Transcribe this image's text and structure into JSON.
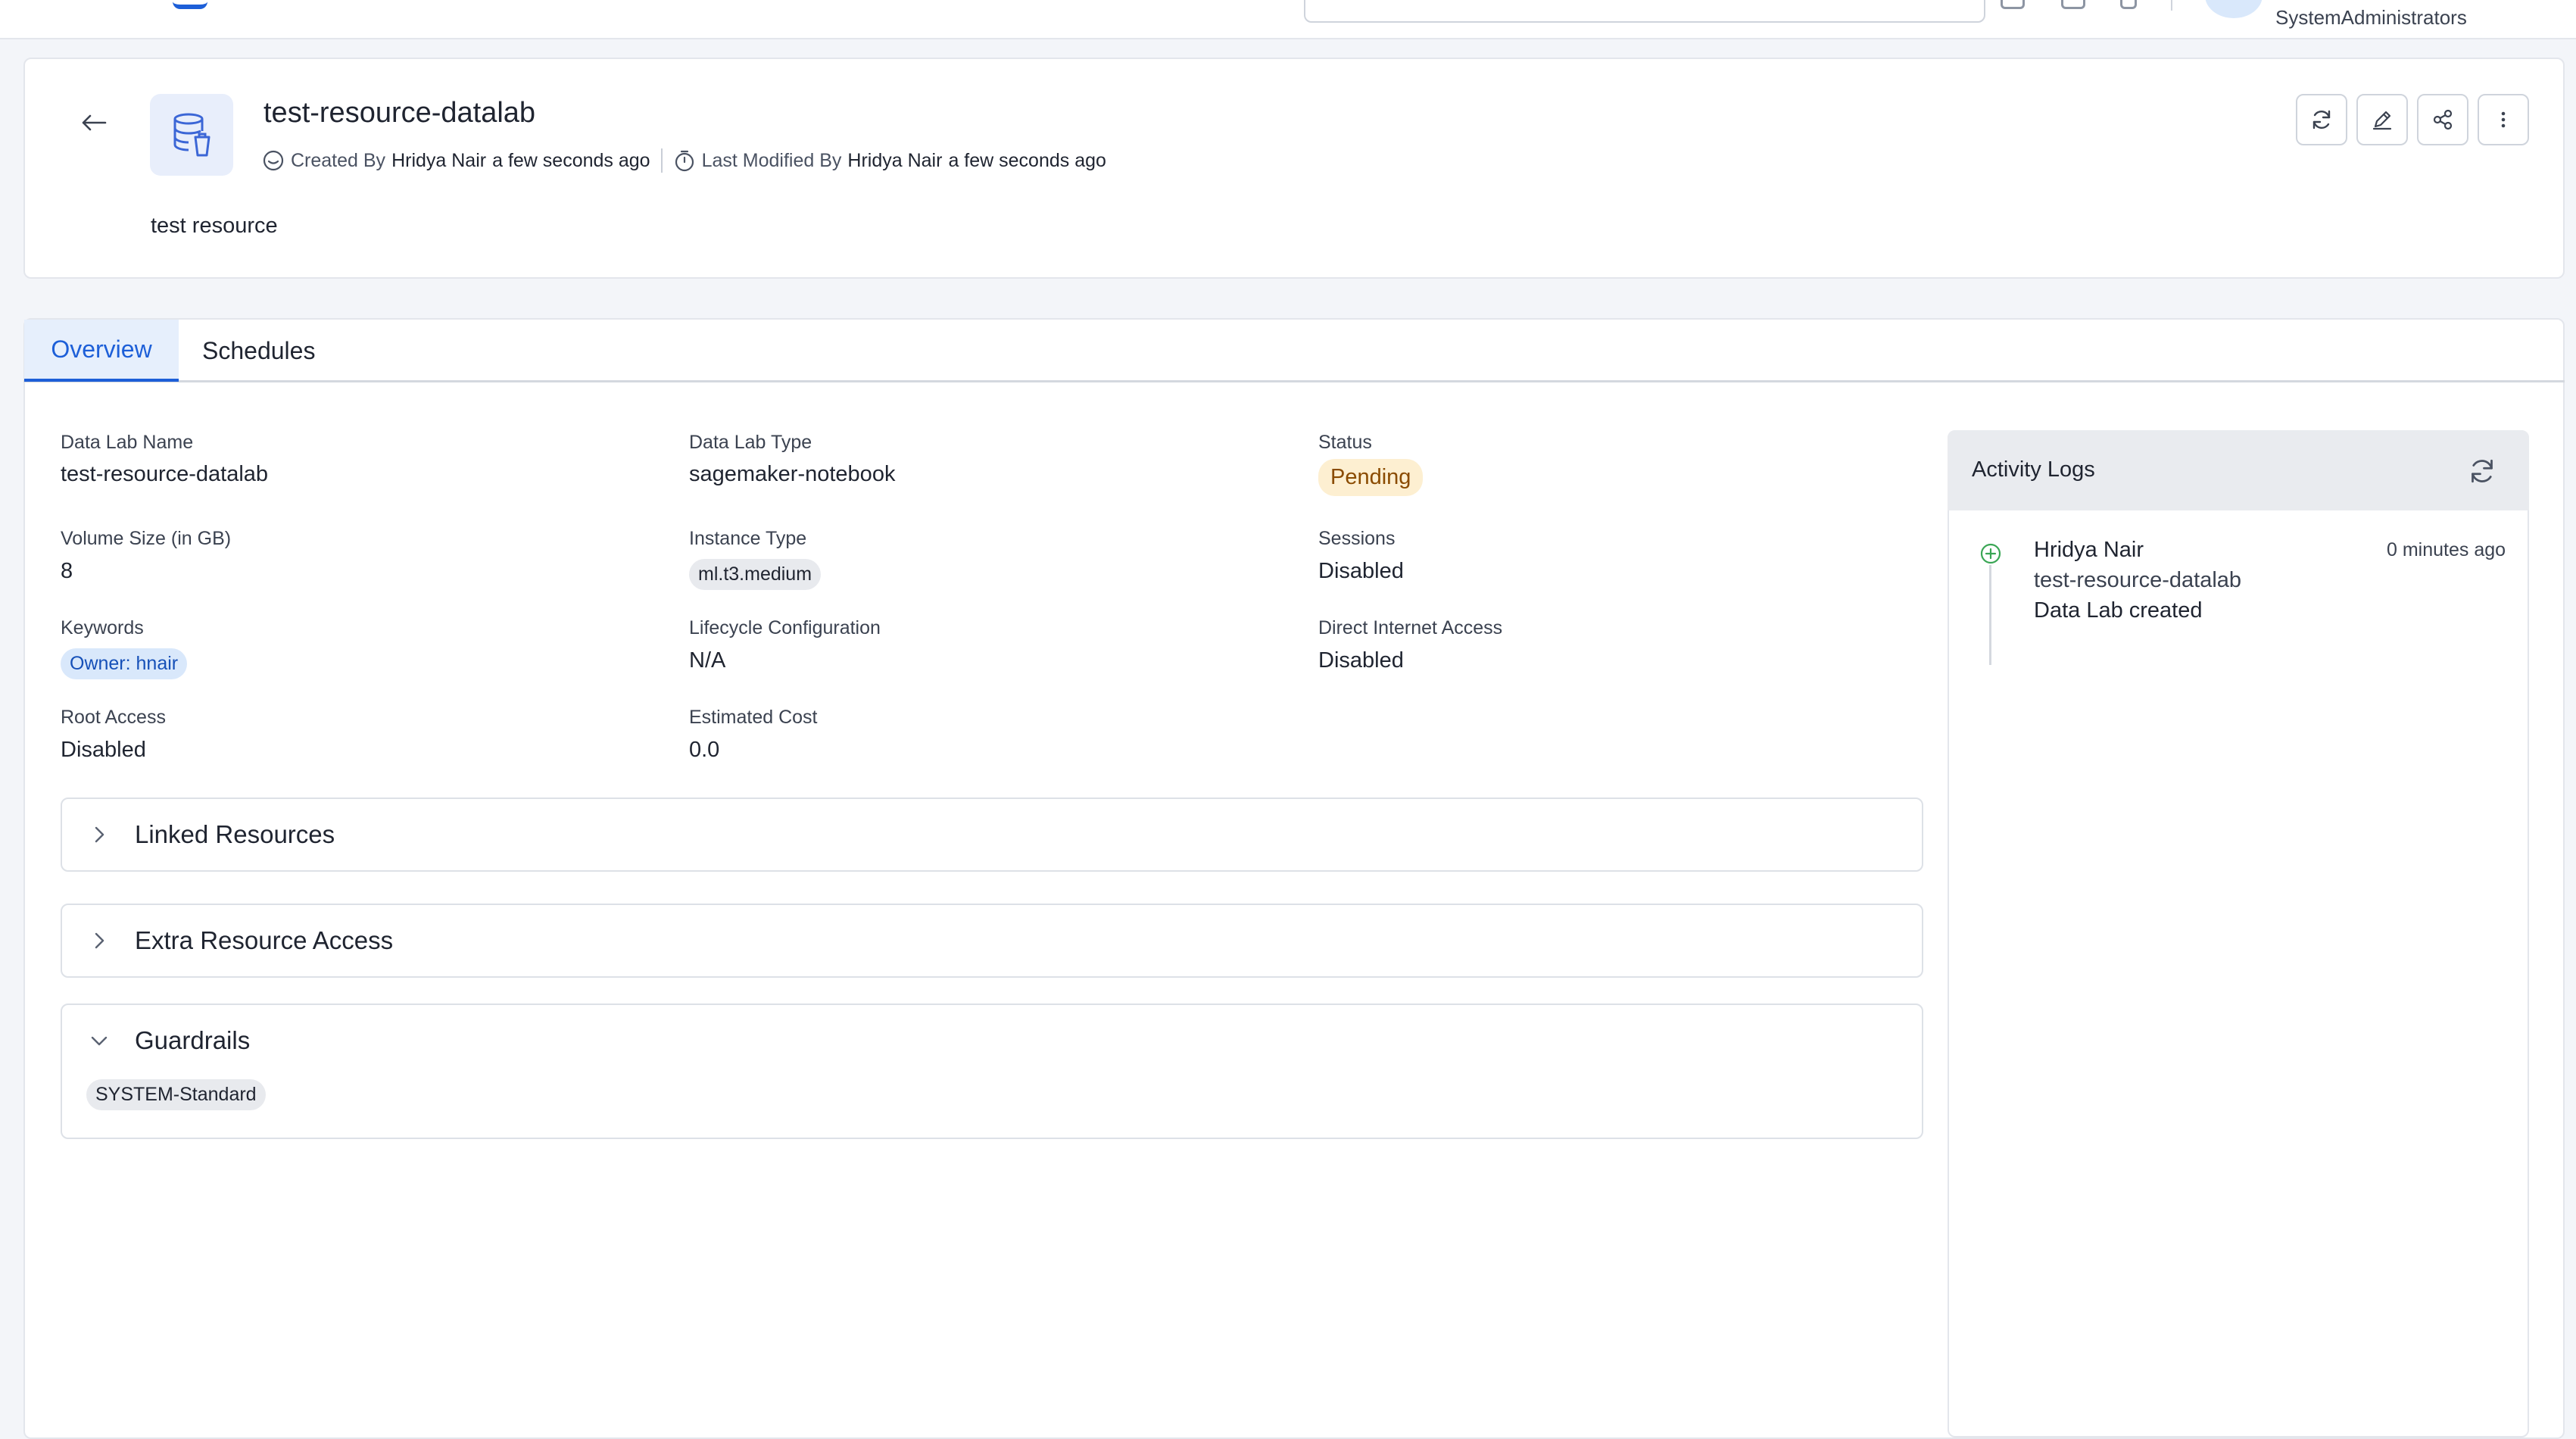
{
  "topbar": {
    "user_group": "SystemAdministrators"
  },
  "header": {
    "title": "test-resource-datalab",
    "created_by_label": "Created By",
    "created_by_user": "Hridya Nair",
    "created_time": "a few seconds ago",
    "modified_by_label": "Last Modified By",
    "modified_by_user": "Hridya Nair",
    "modified_time": "a few seconds ago",
    "description": "test resource",
    "actions": [
      "refresh-icon",
      "edit-icon",
      "share-icon",
      "more-vertical-icon"
    ]
  },
  "tabs": [
    {
      "label": "Overview",
      "active": true
    },
    {
      "label": "Schedules",
      "active": false
    }
  ],
  "fields": {
    "data_lab_name": {
      "label": "Data Lab Name",
      "value": "test-resource-datalab"
    },
    "data_lab_type": {
      "label": "Data Lab Type",
      "value": "sagemaker-notebook"
    },
    "status": {
      "label": "Status",
      "value": "Pending"
    },
    "volume_size": {
      "label": "Volume Size (in GB)",
      "value": "8"
    },
    "instance_type": {
      "label": "Instance Type",
      "value": "ml.t3.medium"
    },
    "sessions": {
      "label": "Sessions",
      "value": "Disabled"
    },
    "keywords": {
      "label": "Keywords",
      "value": "Owner: hnair"
    },
    "lifecycle_configuration": {
      "label": "Lifecycle Configuration",
      "value": "N/A"
    },
    "direct_internet_access": {
      "label": "Direct Internet Access",
      "value": "Disabled"
    },
    "root_access": {
      "label": "Root Access",
      "value": "Disabled"
    },
    "estimated_cost": {
      "label": "Estimated Cost",
      "value": "0.0"
    }
  },
  "sections": {
    "linked_resources": {
      "title": "Linked Resources",
      "expanded": false
    },
    "extra_resource_access": {
      "title": "Extra Resource Access",
      "expanded": false
    },
    "guardrails": {
      "title": "Guardrails",
      "expanded": true,
      "items": [
        "SYSTEM-Standard"
      ]
    }
  },
  "activity_logs": {
    "title": "Activity Logs",
    "entries": [
      {
        "user": "Hridya Nair",
        "time": "0 minutes ago",
        "resource": "test-resource-datalab",
        "message": "Data Lab created"
      }
    ]
  },
  "colors": {
    "accent": "#1d5fd8",
    "pending_bg": "#fdefd1",
    "pending_text": "#8a4b00",
    "success_icon": "#3aa655"
  }
}
